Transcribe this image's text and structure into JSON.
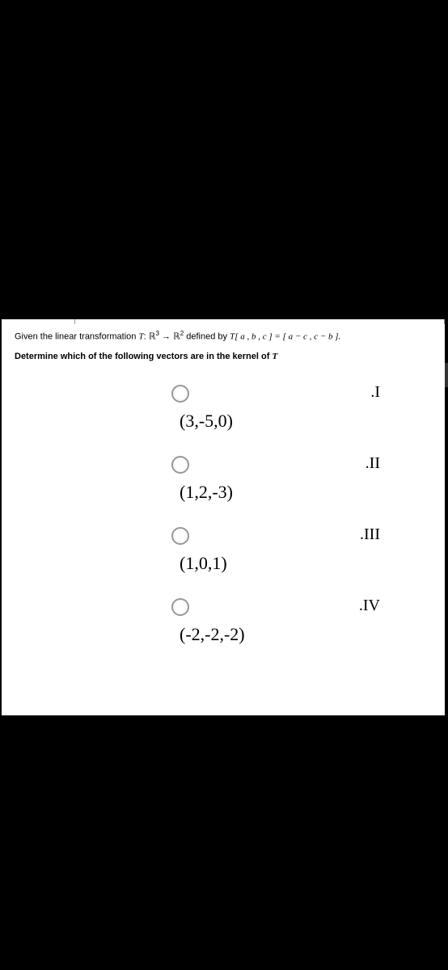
{
  "question": {
    "line1_prefix": "Given the linear transformation ",
    "transformation_T": "T",
    "colon": ": ",
    "R3": "ℝ",
    "sup3": "3",
    "arrow": " → ",
    "R2": "ℝ",
    "sup2": "2",
    "defined_by": " defined by ",
    "formula_T": "T",
    "formula_bracket": "[ a  ,  b  ,  c ] = [ a − c  ,  c − b ].",
    "line2": "Determine which of the following vectors are in the kernel of ",
    "line2_T": "T"
  },
  "options": [
    {
      "roman": ".I",
      "vector": "(3,-5,0)"
    },
    {
      "roman": ".II",
      "vector": "(1,2,-3)"
    },
    {
      "roman": ".III",
      "vector": "(1,0,1)"
    },
    {
      "roman": ".IV",
      "vector": "(-2,-2,-2)"
    }
  ]
}
